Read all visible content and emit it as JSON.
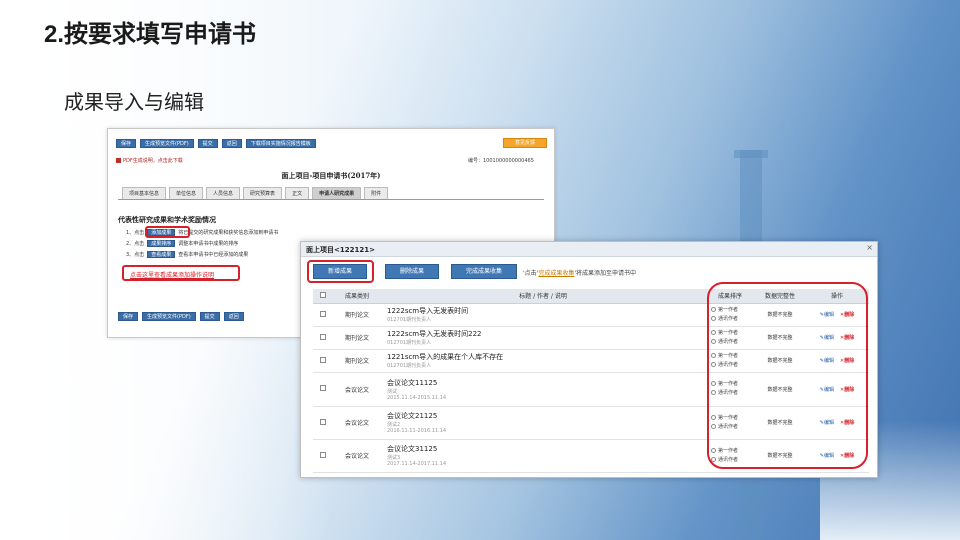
{
  "slide": {
    "number": "2.",
    "title": "按要求填写申请书",
    "subtitle": "成果导入与编辑"
  },
  "colors": {
    "primary_button": "#3f78b5",
    "highlight_red": "#d6202a",
    "orange_button": "#f6a52b"
  },
  "back_window": {
    "toolbar": [
      "保存",
      "生成预览文件(PDF)",
      "提交",
      "返回",
      "下载项目实施情况报告模板"
    ],
    "orange_button": "意见反馈",
    "pdf_link": "PDF生成说明，点击此下载",
    "app_number": "编号：1001000000000465",
    "doc_title": "面上项目-项目申请书(2017年)",
    "tabs": [
      "项目基本信息",
      "单位信息",
      "人员信息",
      "研究预算表",
      "正文",
      "申请人研究成果",
      "附件"
    ],
    "active_tab_index": 5,
    "section_heading": "代表性研究成果和学术奖励情况",
    "steps": [
      {
        "prefix": "1、点击",
        "button": "添加成果",
        "text": "将已提交的研究成果和获奖信息添加到申请书"
      },
      {
        "prefix": "2、点击",
        "button": "成果排序",
        "text": "调整本申请书中成果的排序"
      },
      {
        "prefix": "3、点击",
        "button": "查看成果",
        "text": "查看本申请书中已经添加的成果"
      }
    ],
    "help_link": "点击这里查看成果添加操作说明",
    "bottom_toolbar": [
      "保存",
      "生成预览文件(PDF)",
      "提交",
      "返回"
    ]
  },
  "front_window": {
    "title": "面上项目<122121>",
    "close": "×",
    "buttons": {
      "add": "新增成果",
      "delete": "删除成果",
      "complete": "完成成果收集"
    },
    "hint_prefix": "'点击'",
    "hint_link": "完成成果收集",
    "hint_suffix": "'将成果添加至申请书中",
    "columns": {
      "category": "成果类别",
      "title": "标题 / 作者 / 说明",
      "rank": "成果排序",
      "status": "数据完整性",
      "ops": "操作"
    },
    "rank_options": [
      "第一作者",
      "通讯作者"
    ],
    "op_edit": "编辑",
    "op_delete": "删除",
    "rows": [
      {
        "category": "期刊论文",
        "title": "1222scm导入无发表时间",
        "sub": "012701期刊负责人",
        "status": "数据不完整"
      },
      {
        "category": "期刊论文",
        "title": "1222scm导入无发表时间222",
        "sub": "012701期刊负责人",
        "status": "数据不完整"
      },
      {
        "category": "期刊论文",
        "title": "1221scm导入的成果在个人库不存在",
        "sub": "012701期刊负责人",
        "status": "数据不完整"
      },
      {
        "category": "会议论文",
        "title": "会议论文11125",
        "sub": "测试",
        "date": "2015.11.14-2015.11.14",
        "status": "数据不完整"
      },
      {
        "category": "会议论文",
        "title": "会议论文21125",
        "sub": "测试2",
        "date": "2016.11.11-2016.11.14",
        "status": "数据不完整"
      },
      {
        "category": "会议论文",
        "title": "会议论文31125",
        "sub": "测试3",
        "date": "2017.11.14-2017.11.14",
        "status": "数据不完整"
      }
    ]
  }
}
